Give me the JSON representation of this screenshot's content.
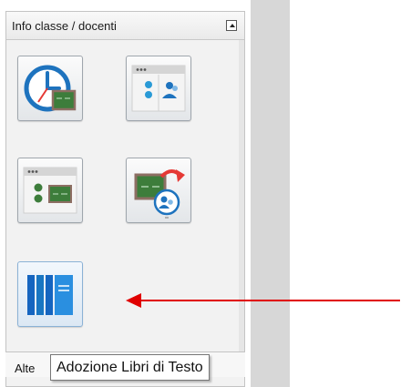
{
  "panel": {
    "title": "Info classe / docenti",
    "bottom_tab_label": "Alte"
  },
  "tiles": [
    {
      "icon": "clock-blackboard-icon"
    },
    {
      "icon": "class-window-teacher-icon"
    },
    {
      "icon": "class-window-board-icon"
    },
    {
      "icon": "blackboard-teacher-export-icon"
    },
    {
      "icon": "textbooks-icon"
    }
  ],
  "tooltip": {
    "text": "Adozione Libri di Testo"
  },
  "colors": {
    "arrow": "#e00000",
    "tile_blue": "#1976c2",
    "board_green": "#3d7d3b"
  }
}
